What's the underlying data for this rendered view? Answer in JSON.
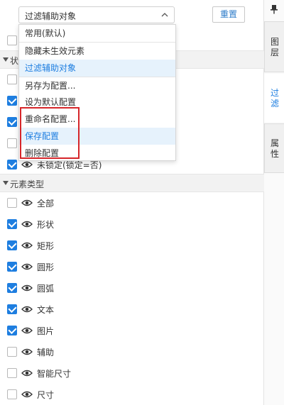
{
  "toolbar": {
    "filter_selected": "过滤辅助对象",
    "reset_label": "重置"
  },
  "dropdown": {
    "items": [
      "常用(默认)",
      "隐藏未生效元素",
      "过滤辅助对象",
      "另存为配置...",
      "设为默认配置",
      "重命名配置...",
      "保存配置",
      "删除配置"
    ]
  },
  "status_section": {
    "title": "状",
    "rows": [
      {
        "label": "",
        "checked": false
      },
      {
        "label": "",
        "checked": true
      },
      {
        "label": "",
        "checked": true
      },
      {
        "label": "",
        "checked": false
      },
      {
        "label": "未锁定(锁定=否)",
        "checked": true
      }
    ]
  },
  "element_types": {
    "title": "元素类型",
    "rows": [
      {
        "label": "全部",
        "checked": false
      },
      {
        "label": "形状",
        "checked": true
      },
      {
        "label": "矩形",
        "checked": true
      },
      {
        "label": "圆形",
        "checked": true
      },
      {
        "label": "圆弧",
        "checked": true
      },
      {
        "label": "文本",
        "checked": true
      },
      {
        "label": "图片",
        "checked": true
      },
      {
        "label": "辅助",
        "checked": false
      },
      {
        "label": "智能尺寸",
        "checked": false
      },
      {
        "label": "尺寸",
        "checked": false
      }
    ]
  },
  "side_tabs": [
    "图层",
    "过滤",
    "属性"
  ],
  "colors": {
    "accent": "#1e7ee0",
    "highlight": "#e6f2fc",
    "annotation_red": "#d6262a"
  },
  "icons": {
    "chevron": "chevron-down-icon",
    "eye": "eye-icon",
    "pin": "pin-icon"
  }
}
